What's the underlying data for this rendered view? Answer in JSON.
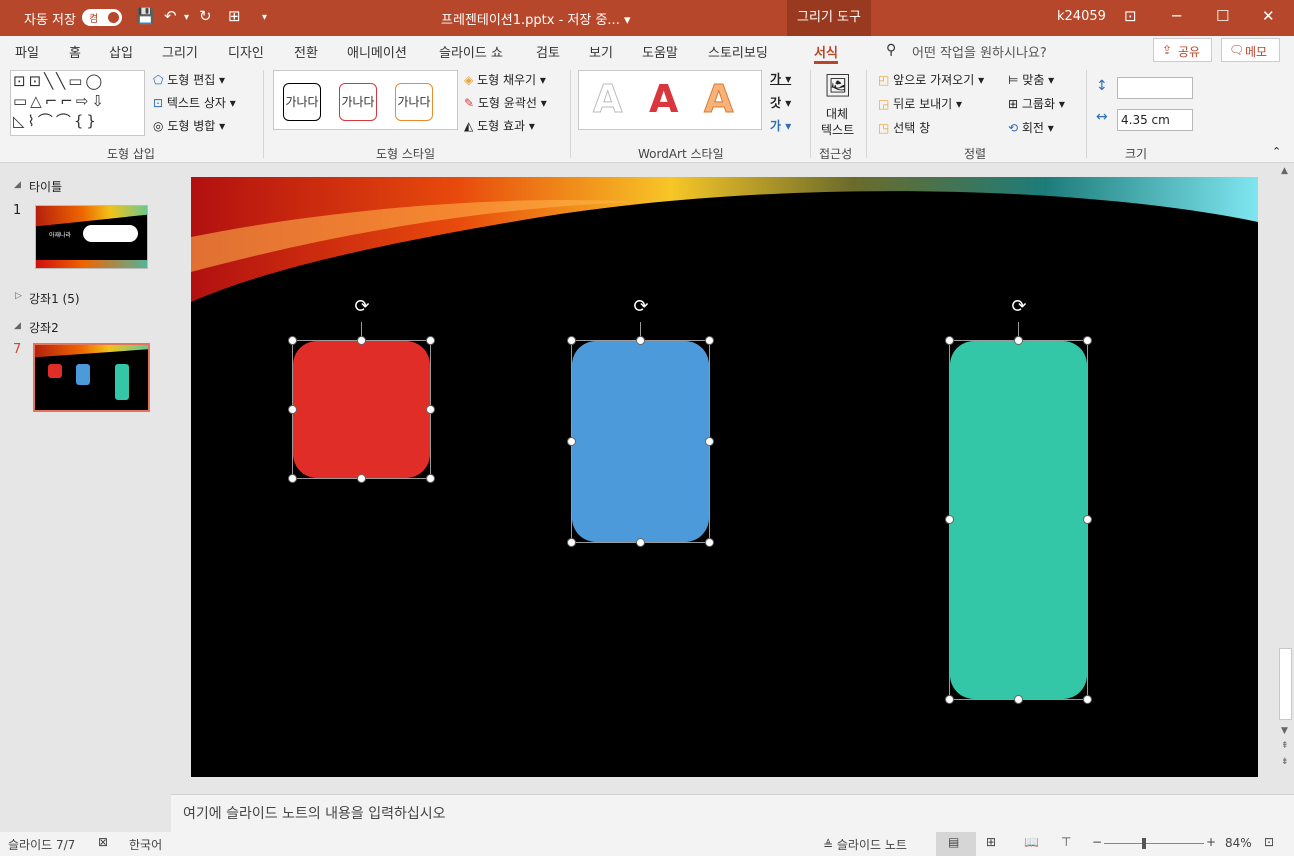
{
  "titlebar": {
    "autosave_label": "자동 저장",
    "autosave_state": "켬",
    "doc_title": "프레젠테이션1.pptx - 저장 중... ▾",
    "context_tab": "그리기 도구",
    "user": "k24059"
  },
  "menu": {
    "tabs": [
      "파일",
      "홈",
      "삽입",
      "그리기",
      "디자인",
      "전환",
      "애니메이션",
      "슬라이드 쇼",
      "검토",
      "보기",
      "도움말",
      "스토리보딩",
      "서식"
    ],
    "search_placeholder": "어떤 작업을 원하시나요?",
    "share_label": "공유",
    "comments_label": "메모"
  },
  "ribbon": {
    "shape_edit": "도형 편집 ▾",
    "text_box": "텍스트 상자 ▾",
    "shape_merge": "도형 병합 ▾",
    "group_insert": "도형 삽입",
    "style_preview": "가나다",
    "shape_fill": "도형 채우기 ▾",
    "shape_outline": "도형 윤곽선 ▾",
    "shape_effect": "도형 효과 ▾",
    "group_style": "도형 스타일",
    "group_wordart": "WordArt 스타일",
    "wordart_letter": "A",
    "alt_text_1": "대체",
    "alt_text_2": "텍스트",
    "group_access": "접근성",
    "bring_forward": "앞으로 가져오기 ▾",
    "send_back": "뒤로 보내기 ▾",
    "selection_pane": "선택 창",
    "align": "맞춤 ▾",
    "group": "그룹화 ▾",
    "rotate": "회전 ▾",
    "group_arrange": "정렬",
    "height_value": "",
    "width_value": "4.35 cm",
    "group_size": "크기"
  },
  "thumbnails": {
    "section1": "타이틀",
    "slide1_num": "1",
    "slide1_caption": "아재나라",
    "section2": "강좌1 (5)",
    "section3": "강좌2",
    "slide7_num": "7"
  },
  "notes_placeholder": "여기에 슬라이드 노트의 내용을 입력하십시오",
  "status": {
    "slide_pos": "슬라이드 7/7",
    "language": "한국어",
    "notes_btn": "슬라이드 노트",
    "zoom": "84%"
  },
  "colors": {
    "accent": "#b7472a",
    "shape_red": "#e12d27",
    "shape_blue": "#4d9adb",
    "shape_green": "#33c6a7"
  }
}
